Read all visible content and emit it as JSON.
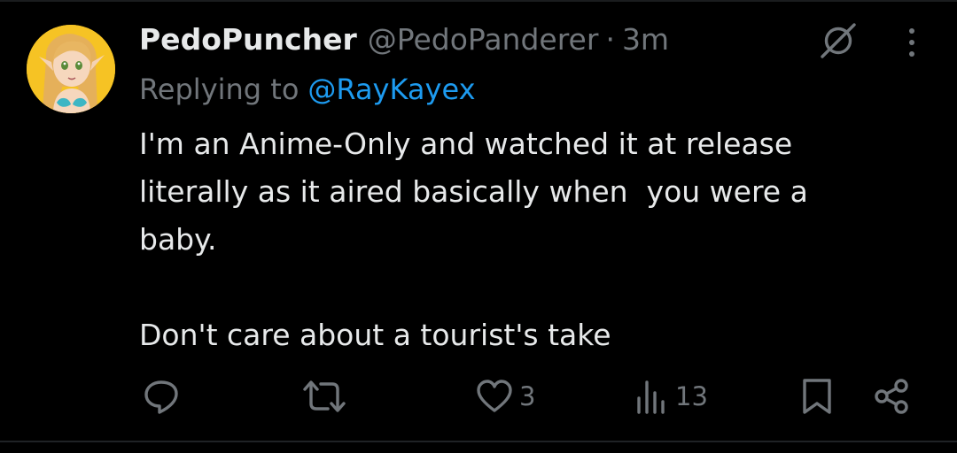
{
  "tweet": {
    "display_name": "PedoPuncher",
    "handle": "@PedoPanderer",
    "separator": "·",
    "time": "3m",
    "replying_prefix": "Replying to",
    "replying_to": "@RayKayex",
    "body_lines": [
      "I'm an Anime-Only and watched it at release",
      "literally as it aired basically when  you were a",
      "baby.",
      "Don't care about a tourist's take"
    ]
  },
  "actions": {
    "reply_count": "",
    "retweet_count": "",
    "like_count": "3",
    "views_count": "13"
  },
  "icons": {
    "avatar": "avatar-image",
    "grok": "grok-icon",
    "more": "more-options-icon",
    "reply": "reply-icon",
    "retweet": "retweet-icon",
    "like": "heart-icon",
    "views": "views-chart-icon",
    "bookmark": "bookmark-icon",
    "share": "share-icon"
  },
  "colors": {
    "background": "#000000",
    "text_primary": "#e7e9ea",
    "text_secondary": "#71767b",
    "accent_blue": "#1d9bf0"
  }
}
